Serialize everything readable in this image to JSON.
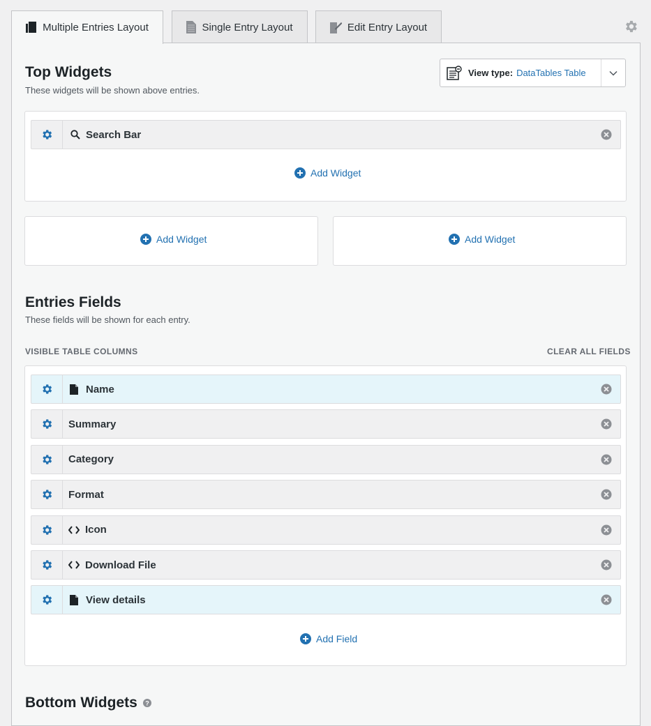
{
  "tabs": [
    {
      "label": "Multiple Entries Layout",
      "icon": "multiple-entries-icon",
      "active": true
    },
    {
      "label": "Single Entry Layout",
      "icon": "single-entry-icon",
      "active": false
    },
    {
      "label": "Edit Entry Layout",
      "icon": "edit-entry-icon",
      "active": false
    }
  ],
  "view_type": {
    "label": "View type:",
    "value": "DataTables Table"
  },
  "top_widgets": {
    "title": "Top Widgets",
    "description": "These widgets will be shown above entries.",
    "widgets": [
      {
        "label": "Search Bar",
        "icon": "search-icon"
      }
    ],
    "add_label": "Add Widget",
    "left_add_label": "Add Widget",
    "right_add_label": "Add Widget"
  },
  "entries_fields": {
    "title": "Entries Fields",
    "description": "These fields will be shown for each entry.",
    "columns_caption": "VISIBLE TABLE COLUMNS",
    "clear_all": "CLEAR ALL FIELDS",
    "fields": [
      {
        "label": "Name",
        "icon": "document-icon",
        "highlight": true
      },
      {
        "label": "Summary",
        "icon": "",
        "highlight": false
      },
      {
        "label": "Category",
        "icon": "",
        "highlight": false
      },
      {
        "label": "Format",
        "icon": "",
        "highlight": false
      },
      {
        "label": "Icon",
        "icon": "code-icon",
        "highlight": false
      },
      {
        "label": "Download File",
        "icon": "code-icon",
        "highlight": false
      },
      {
        "label": "View details",
        "icon": "document-icon",
        "highlight": true
      }
    ],
    "add_label": "Add Field"
  },
  "bottom_widgets": {
    "title": "Bottom Widgets"
  },
  "colors": {
    "accent": "#2271b1",
    "highlight_row": "#e5f5fa",
    "row": "#f0f0f1",
    "text": "#1d2327"
  }
}
